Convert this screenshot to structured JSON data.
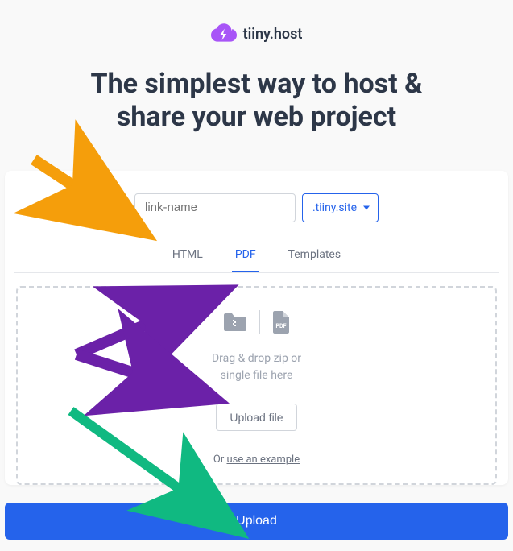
{
  "logo": {
    "text": "tiiny.host"
  },
  "headline_line1": "The simplest way to host &",
  "headline_line2": "share your web project",
  "url": {
    "placeholder": "link-name",
    "domain": ".tiiny.site"
  },
  "tabs": {
    "html": "HTML",
    "pdf": "PDF",
    "templates": "Templates"
  },
  "dropzone": {
    "line1": "Drag & drop zip or",
    "line2": "single file here",
    "upload_file": "Upload file",
    "or_text": "Or ",
    "example_link": "use an example"
  },
  "upload_button": "Upload"
}
